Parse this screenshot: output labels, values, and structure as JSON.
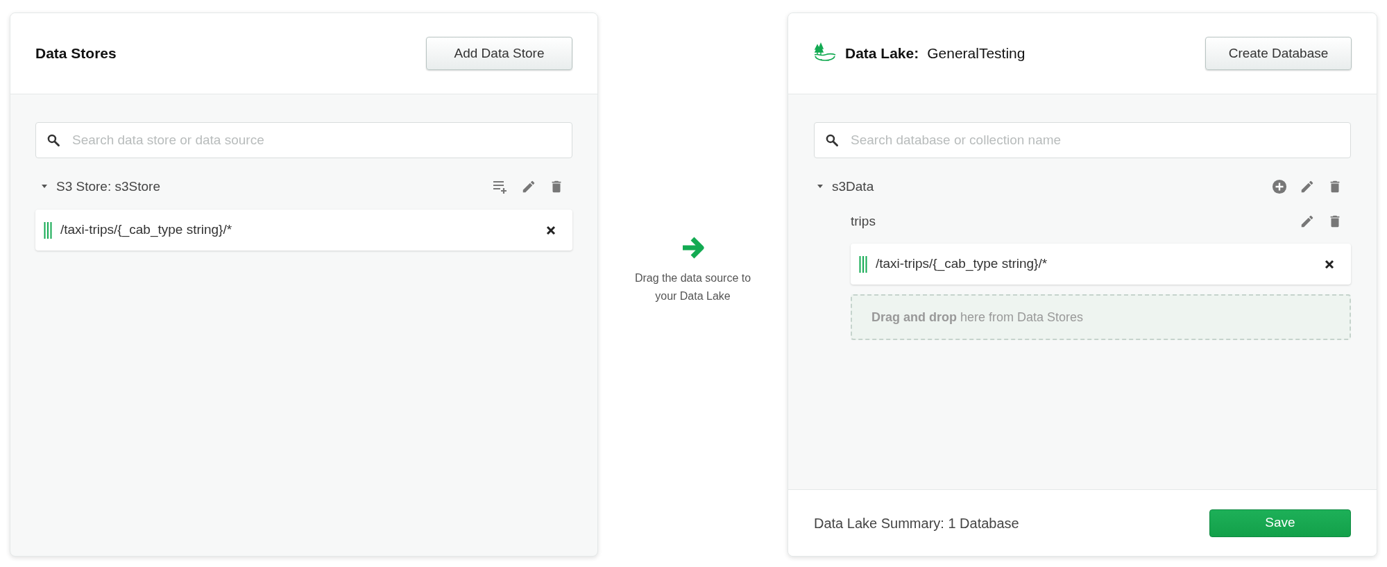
{
  "stores_panel": {
    "title": "Data Stores",
    "add_button": "Add Data Store",
    "search": {
      "placeholder": "Search data store or data source"
    },
    "stores": [
      {
        "label": "S3 Store: s3Store",
        "expanded": true,
        "sources": [
          {
            "path": "/taxi-trips/{_cab_type string}/*"
          }
        ]
      }
    ]
  },
  "hint": {
    "text": "Drag the data source to your Data Lake"
  },
  "lake_panel": {
    "title_label": "Data Lake:",
    "title_name": "GeneralTesting",
    "create_button": "Create Database",
    "search": {
      "placeholder": "Search database or collection name"
    },
    "databases": [
      {
        "name": "s3Data",
        "expanded": true,
        "collections": [
          {
            "name": "trips",
            "sources": [
              {
                "path": "/taxi-trips/{_cab_type string}/*"
              }
            ],
            "dropzone": "**Drag and drop** here from Data Stores"
          }
        ]
      }
    ],
    "summary": "Data Lake Summary: 1 Database",
    "save_button": "Save"
  }
}
